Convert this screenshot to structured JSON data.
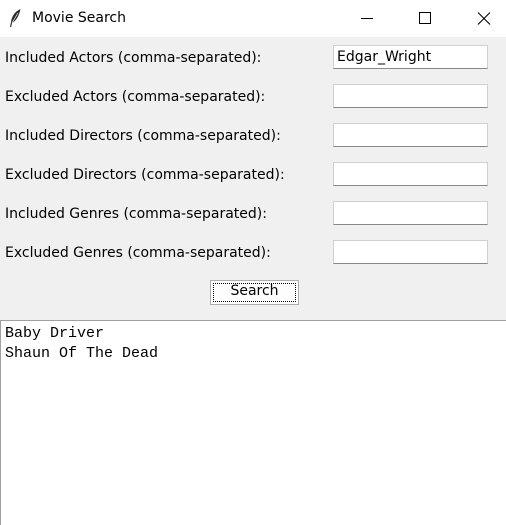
{
  "window": {
    "title": "Movie Search",
    "icon": "feather-icon",
    "controls": [
      "minimize-icon",
      "maximize-icon",
      "close-icon"
    ]
  },
  "form": {
    "rows": [
      {
        "label": "Included Actors (comma-separated):",
        "value": "Edgar_Wright"
      },
      {
        "label": "Excluded Actors (comma-separated):",
        "value": ""
      },
      {
        "label": "Included Directors (comma-separated):",
        "value": ""
      },
      {
        "label": "Excluded Directors (comma-separated):",
        "value": ""
      },
      {
        "label": "Included Genres (comma-separated):",
        "value": ""
      },
      {
        "label": "Excluded Genres (comma-separated):",
        "value": ""
      }
    ],
    "search_label": "Search"
  },
  "results": {
    "lines": [
      "Baby Driver",
      "Shaun Of The Dead"
    ]
  }
}
